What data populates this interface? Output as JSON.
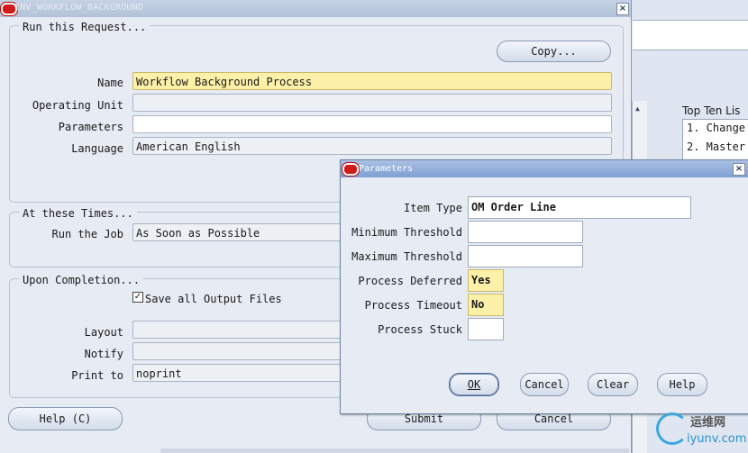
{
  "main_window": {
    "title": "INV_WORKFLOW_BACKGROUND",
    "close_glyph": "×",
    "run_request": {
      "group_title": "Run this Request...",
      "copy_button": "Copy...",
      "name_label": "Name",
      "name_value": "Workflow Background Process",
      "operating_unit_label": "Operating Unit",
      "operating_unit_value": "",
      "parameters_label": "Parameters",
      "parameters_value": "",
      "language_label": "Language",
      "language_value": "American English"
    },
    "times": {
      "group_title": "At these Times...",
      "run_job_label": "Run the Job",
      "run_job_value": "As Soon as Possible"
    },
    "completion": {
      "group_title": "Upon Completion...",
      "save_output_label": "Save all Output Files",
      "save_output_checked": true,
      "layout_label": "Layout",
      "layout_value": "",
      "notify_label": "Notify",
      "notify_value": "",
      "print_to_label": "Print to",
      "print_to_value": "noprint"
    },
    "footer": {
      "help_button": "Help (C)",
      "submit_button": "Submit",
      "cancel_button": "Cancel"
    }
  },
  "background_window": {
    "top_ten_label": "Top Ten Lis",
    "items": [
      "1. Change",
      "2. Master"
    ]
  },
  "parameters_dialog": {
    "title": "Parameters",
    "close_glyph": "×",
    "fields": [
      {
        "label": "Item Type",
        "value": "OM Order Line",
        "style": "white"
      },
      {
        "label": "Minimum Threshold",
        "value": "",
        "style": "white"
      },
      {
        "label": "Maximum Threshold",
        "value": "",
        "style": "white"
      },
      {
        "label": "Process Deferred",
        "value": "Yes",
        "style": "yellow"
      },
      {
        "label": "Process Timeout",
        "value": "No",
        "style": "yellow"
      },
      {
        "label": "Process Stuck",
        "value": "",
        "style": "white"
      }
    ],
    "buttons": {
      "ok": "OK",
      "cancel": "Cancel",
      "clear": "Clear",
      "help": "Help"
    }
  },
  "watermark": {
    "cn": "运维网",
    "en": "iyunv.com"
  },
  "colors": {
    "required_field": "#fdf0a8",
    "dialog_titlebar": "#7f9fd2",
    "window_background": "#e7ebf3",
    "oracle_red": "#d21a1a"
  }
}
